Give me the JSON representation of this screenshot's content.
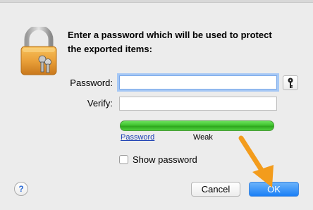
{
  "dialog": {
    "prompt_line1": "Enter a password which will be used to protect",
    "prompt_line2": "the exported items:"
  },
  "form": {
    "password_label": "Password:",
    "verify_label": "Verify:",
    "password_value": "",
    "verify_value": ""
  },
  "strength": {
    "link_label": "Password",
    "rating": "Weak",
    "fill_fraction": 1.0,
    "color": "#3fc22e"
  },
  "options": {
    "show_password_label": "Show password",
    "show_password_checked": false
  },
  "buttons": {
    "help_label": "?",
    "cancel_label": "Cancel",
    "ok_label": "OK"
  },
  "annotation": {
    "arrow_color": "#f39c1c"
  },
  "icons": {
    "lock": "lock-icon",
    "key": "key-icon",
    "arrow": "arrow-annotation-icon"
  }
}
